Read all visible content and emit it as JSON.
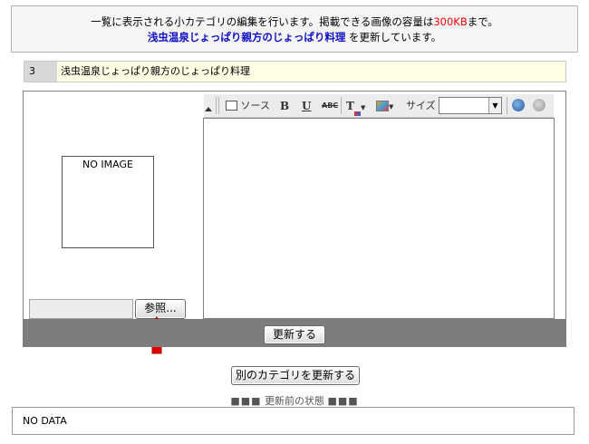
{
  "notice": {
    "line1_pre": "一覧に表示される小カテゴリの編集を行います。掲載できる画像の容量は",
    "line1_limit": "300KB",
    "line1_post": "まで。",
    "line2_name": "浅虫温泉じょっぱり親方のじょっぱり料理",
    "line2_post": " を更新しています。"
  },
  "title_row": {
    "number": "3",
    "name": "浅虫温泉じょっぱり親方のじょっぱり料理"
  },
  "image_panel": {
    "placeholder": "NO IMAGE",
    "browse_label": "参照..."
  },
  "toolbar": {
    "source_label": "ソース",
    "bold_label": "B",
    "underline_label": "U",
    "strike_label": "ABC",
    "size_label": "サイズ",
    "size_value": ""
  },
  "buttons": {
    "update_label": "更新する",
    "other_category_label": "別のカテゴリを更新する"
  },
  "before_state": {
    "label": "更新前の状態",
    "content": "NO DATA"
  },
  "colors": {
    "highlight_red": "#ff0000",
    "name_blue": "#1010c8",
    "submit_bar": "#7d7d7d",
    "arrow_red": "#e00000"
  }
}
